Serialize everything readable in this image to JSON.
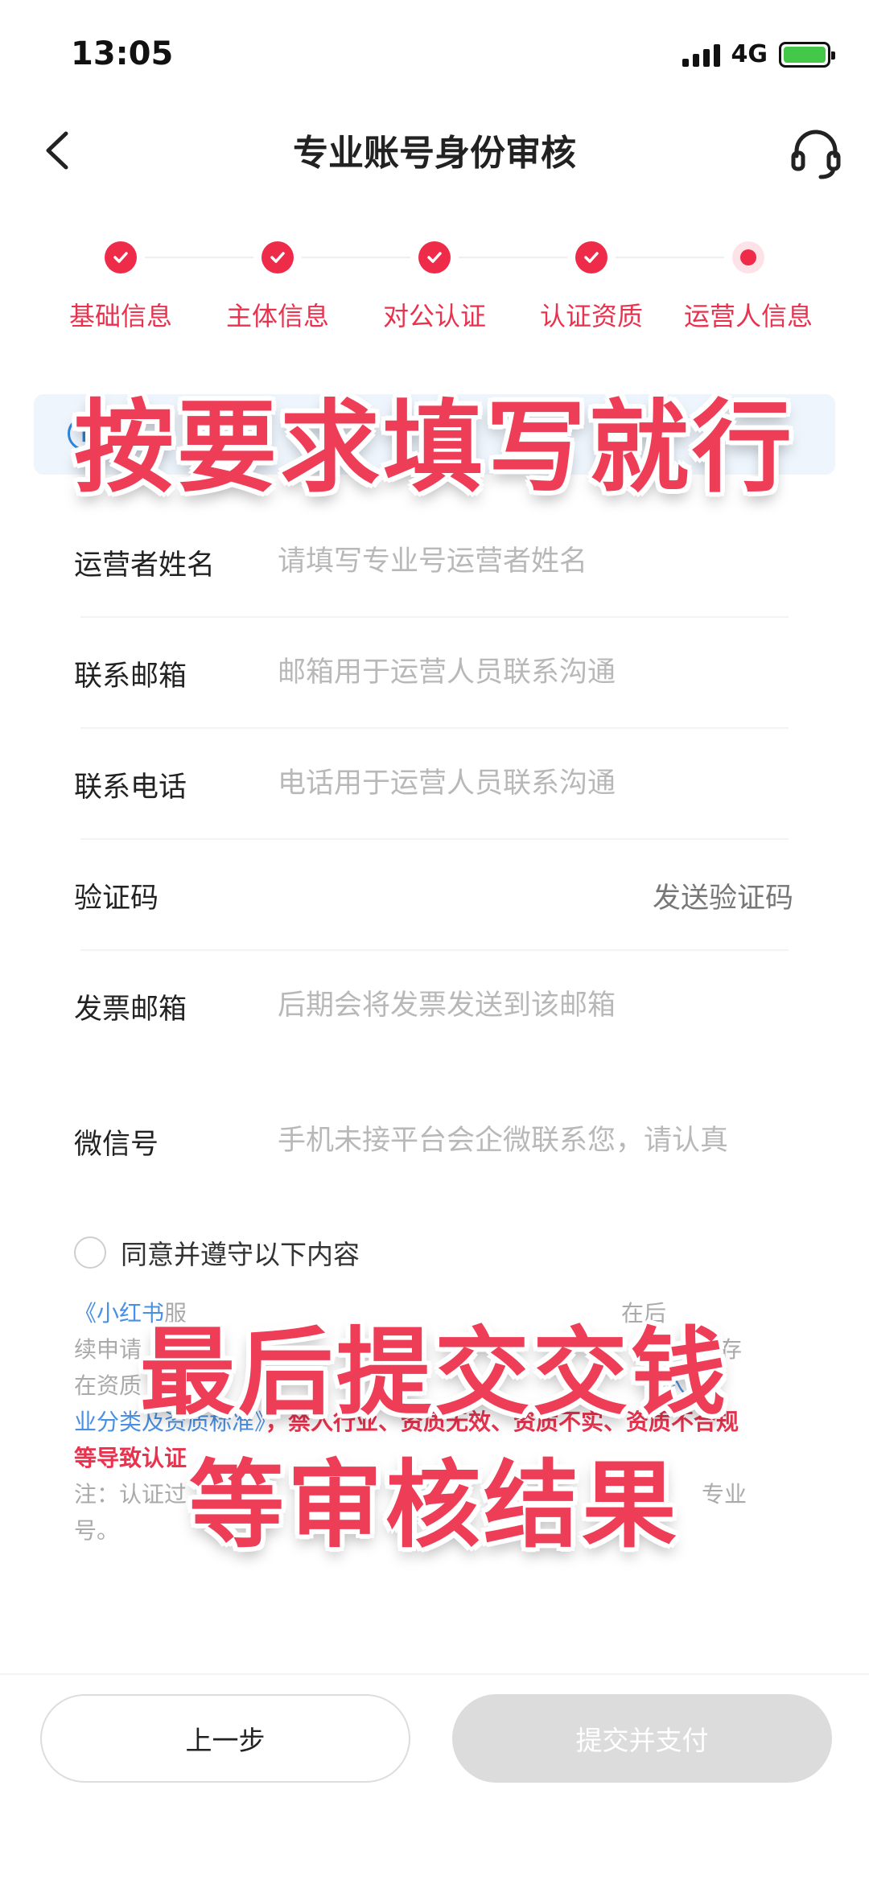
{
  "status_bar": {
    "time": "13:05",
    "network": "4G"
  },
  "nav": {
    "title": "专业账号身份审核",
    "back_icon": "chevron-left-icon",
    "support_icon": "headset-icon"
  },
  "steps": [
    {
      "label": "基础信息",
      "state": "done"
    },
    {
      "label": "主体信息",
      "state": "done"
    },
    {
      "label": "对公认证",
      "state": "done"
    },
    {
      "label": "认证资质",
      "state": "done"
    },
    {
      "label": "运营人信息",
      "state": "current"
    }
  ],
  "form": {
    "operator_name": {
      "label": "运营者姓名",
      "placeholder": "请填写专业号运营者姓名"
    },
    "contact_email": {
      "label": "联系邮箱",
      "placeholder": "邮箱用于运营人员联系沟通"
    },
    "contact_phone": {
      "label": "联系电话",
      "placeholder": "电话用于运营人员联系沟通"
    },
    "verify_code": {
      "label": "验证码",
      "send_label": "发送验证码"
    },
    "invoice_email": {
      "label": "发票邮箱",
      "placeholder": "后期会将发票发送到该邮箱"
    },
    "wechat": {
      "label": "微信号",
      "placeholder": "手机未接平台会企微联系您，请认真"
    }
  },
  "agreement": {
    "label": "同意并遵守以下内容"
  },
  "terms": {
    "line1_blue": "《小红书",
    "line1_gray": "服",
    "line1_tail": "在后",
    "line2_gray": "续申请",
    "line2_tail": "不存",
    "line3_gray": "在资质",
    "line3_blue": "入行",
    "line4_blue": "业分类及资质标准》",
    "line4_red": "，禁入行业、资质无效、资质不实、资质不合规",
    "line5_red": "等导致认证",
    "line6_gray": "注：认证过",
    "line6_tail": "专业",
    "line7_gray": "号。"
  },
  "overlays": {
    "top": "按要求填写就行",
    "bottom_line1": "最后提交交钱",
    "bottom_line2": "等审核结果"
  },
  "buttons": {
    "prev": "上一步",
    "submit": "提交并支付"
  },
  "colors": {
    "accent": "#ee2c4a",
    "link": "#4a90e2",
    "disabled": "#dcdcdc"
  }
}
